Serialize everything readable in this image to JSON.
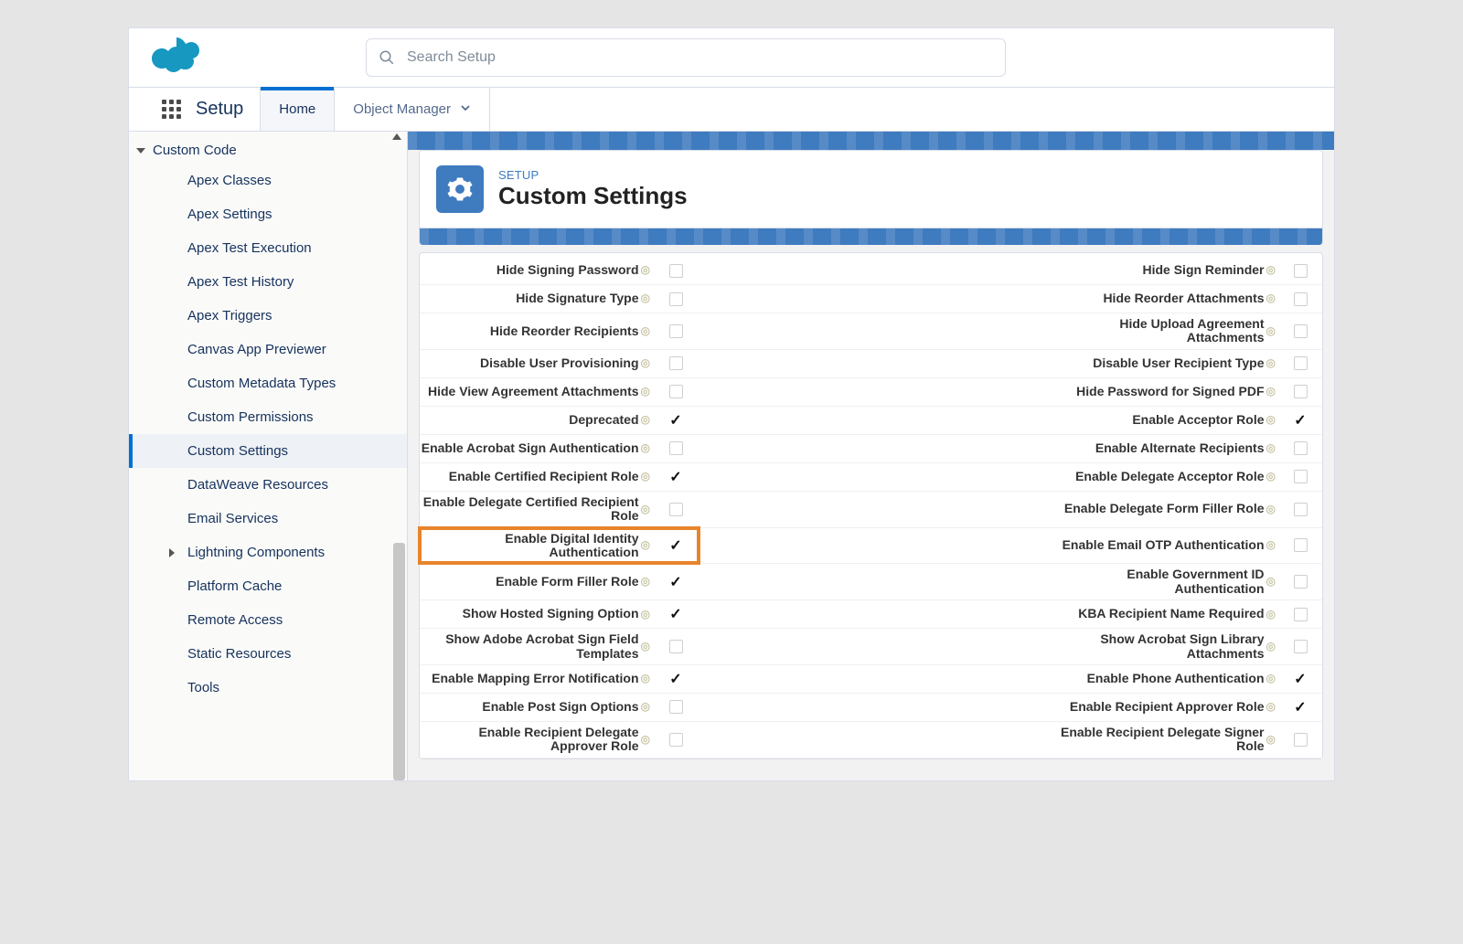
{
  "search": {
    "placeholder": "Search Setup"
  },
  "nav": {
    "app_label": "Setup",
    "tabs": [
      {
        "label": "Home",
        "active": true
      },
      {
        "label": "Object Manager",
        "has_menu": true
      }
    ]
  },
  "sidebar": {
    "section_label": "Custom Code",
    "items": [
      {
        "label": "Apex Classes"
      },
      {
        "label": "Apex Settings"
      },
      {
        "label": "Apex Test Execution"
      },
      {
        "label": "Apex Test History"
      },
      {
        "label": "Apex Triggers"
      },
      {
        "label": "Canvas App Previewer"
      },
      {
        "label": "Custom Metadata Types"
      },
      {
        "label": "Custom Permissions"
      },
      {
        "label": "Custom Settings",
        "active": true
      },
      {
        "label": "DataWeave Resources"
      },
      {
        "label": "Email Services"
      },
      {
        "label": "Lightning Components",
        "expandable": true
      },
      {
        "label": "Platform Cache"
      },
      {
        "label": "Remote Access"
      },
      {
        "label": "Static Resources"
      },
      {
        "label": "Tools"
      }
    ]
  },
  "header": {
    "eyebrow": "SETUP",
    "title": "Custom Settings"
  },
  "highlighted_row_index": 9,
  "settings_rows": [
    {
      "l": "Hide Signing Password",
      "lc": false,
      "r": "Hide Sign Reminder",
      "rc": false
    },
    {
      "l": "Hide Signature Type",
      "lc": false,
      "r": "Hide Reorder Attachments",
      "rc": false
    },
    {
      "l": "Hide Reorder Recipients",
      "lc": false,
      "r": "Hide Upload Agreement Attachments",
      "rc": false
    },
    {
      "l": "Disable User Provisioning",
      "lc": false,
      "r": "Disable User Recipient Type",
      "rc": false
    },
    {
      "l": "Hide View Agreement Attachments",
      "lc": false,
      "r": "Hide Password for Signed PDF",
      "rc": false
    },
    {
      "l": "Deprecated",
      "lc": true,
      "r": "Enable Acceptor Role",
      "rc": true
    },
    {
      "l": "Enable Acrobat Sign Authentication",
      "lc": false,
      "r": "Enable Alternate Recipients",
      "rc": false
    },
    {
      "l": "Enable Certified Recipient Role",
      "lc": true,
      "r": "Enable Delegate Acceptor Role",
      "rc": false
    },
    {
      "l": "Enable Delegate Certified Recipient Role",
      "lc": false,
      "r": "Enable Delegate Form Filler Role",
      "rc": false
    },
    {
      "l": "Enable Digital Identity Authentication",
      "lc": true,
      "r": "Enable Email OTP Authentication",
      "rc": false
    },
    {
      "l": "Enable Form Filler Role",
      "lc": true,
      "r": "Enable Government ID Authentication",
      "rc": false
    },
    {
      "l": "Show Hosted Signing Option",
      "lc": true,
      "r": "KBA Recipient Name Required",
      "rc": false
    },
    {
      "l": "Show Adobe Acrobat Sign Field Templates",
      "lc": false,
      "r": "Show Acrobat Sign Library Attachments",
      "rc": false
    },
    {
      "l": "Enable Mapping Error Notification",
      "lc": true,
      "r": "Enable Phone Authentication",
      "rc": true
    },
    {
      "l": "Enable Post Sign Options",
      "lc": false,
      "r": "Enable Recipient Approver Role",
      "rc": true
    },
    {
      "l": "Enable Recipient Delegate Approver Role",
      "lc": false,
      "r": "Enable Recipient Delegate Signer Role",
      "rc": false
    }
  ]
}
